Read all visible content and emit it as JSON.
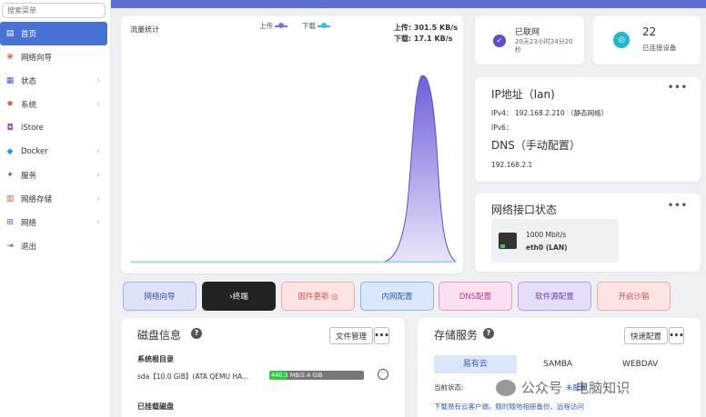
{
  "sidebar": {
    "search_placeholder": "搜索菜单",
    "items": [
      {
        "label": "首页",
        "icon": "home-icon"
      },
      {
        "label": "网络向导",
        "icon": "wizard-icon"
      },
      {
        "label": "状态",
        "icon": "status-icon"
      },
      {
        "label": "系统",
        "icon": "gear-icon"
      },
      {
        "label": "iStore",
        "icon": "store-icon"
      },
      {
        "label": "Docker",
        "icon": "docker-icon"
      },
      {
        "label": "服务",
        "icon": "service-icon"
      },
      {
        "label": "网络存储",
        "icon": "storage-icon"
      },
      {
        "label": "网络",
        "icon": "network-icon"
      },
      {
        "label": "退出",
        "icon": "logout-icon"
      }
    ]
  },
  "traffic": {
    "title": "流量统计",
    "legend_up": "上传",
    "legend_down": "下载",
    "upload": "上传: 301.5 KB/s",
    "download": "下载: 17.1 KB/s",
    "up_color": "#7b6ee0",
    "down_color": "#21c7d9"
  },
  "status": {
    "connected": "已联网",
    "uptime": "20天23小时24分20秒",
    "devices_count": "22",
    "devices_label": "已连接设备"
  },
  "ip": {
    "title": "IP地址（lan)",
    "ipv4": "IPv4： 192.168.2.210 （静态网络）",
    "ipv6": "IPv6：",
    "dns_title": "DNS（手动配置）",
    "dns": "192.168.2.1"
  },
  "iface": {
    "title": "网络接口状态",
    "speed": "1000 Mbit/s",
    "name": "eth0 (LAN)"
  },
  "actions": {
    "wizard": "网络向导",
    "terminal": "›终端",
    "firmware": "固件更新 ◎",
    "lan": "内网配置",
    "dns": "DNS配置",
    "source": "软件源配置",
    "ddns": "开启沙箱"
  },
  "disk": {
    "title": "磁盘信息",
    "manage": "文件管理",
    "root_title": "系统根目录",
    "disk_name": "sda【10.0 GiB】(ATA QEMU HA...",
    "usage_text": "440.3 MB/2.4 GiB",
    "usage_fraction": 0.18,
    "mounted": "已挂载磁盘"
  },
  "storage": {
    "title": "存储服务",
    "quick": "快速配置",
    "tabs": [
      "易有云",
      "SAMBA",
      "WEBDAV"
    ],
    "state_label": "当前状态:",
    "state_value": "未配置",
    "link": "下载易有云客户端，随时随地相册备份、远程访问"
  },
  "watermark": "公众号 · 电脑知识"
}
